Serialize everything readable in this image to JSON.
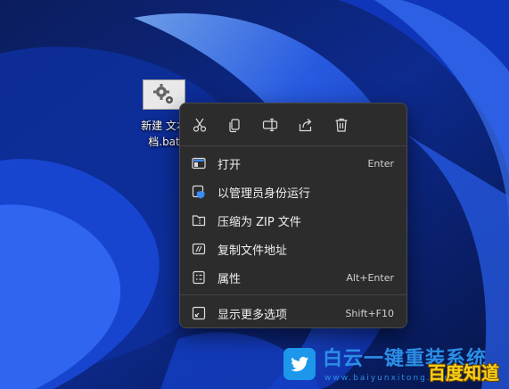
{
  "desktop": {
    "file": {
      "name_line1": "新建 文本",
      "name_line2": "档.bat",
      "icon": "gear-file-icon"
    }
  },
  "context_menu": {
    "toolbar": [
      {
        "icon": "cut-icon"
      },
      {
        "icon": "copy-icon"
      },
      {
        "icon": "rename-icon"
      },
      {
        "icon": "share-icon"
      },
      {
        "icon": "delete-icon"
      }
    ],
    "items": [
      {
        "label": "打开",
        "shortcut": "Enter",
        "icon": "open-icon"
      },
      {
        "label": "以管理员身份运行",
        "shortcut": "",
        "icon": "admin-shield-icon"
      },
      {
        "label": "压缩为 ZIP 文件",
        "shortcut": "",
        "icon": "zip-folder-icon"
      },
      {
        "label": "复制文件地址",
        "shortcut": "",
        "icon": "copy-path-icon"
      },
      {
        "label": "属性",
        "shortcut": "Alt+Enter",
        "icon": "properties-icon"
      }
    ],
    "more": {
      "label": "显示更多选项",
      "shortcut": "Shift+F10",
      "icon": "show-more-icon"
    }
  },
  "watermark": {
    "title": "白云一键重装系统",
    "url": "www.baiyunxitong.com",
    "brand": "百度知道"
  }
}
